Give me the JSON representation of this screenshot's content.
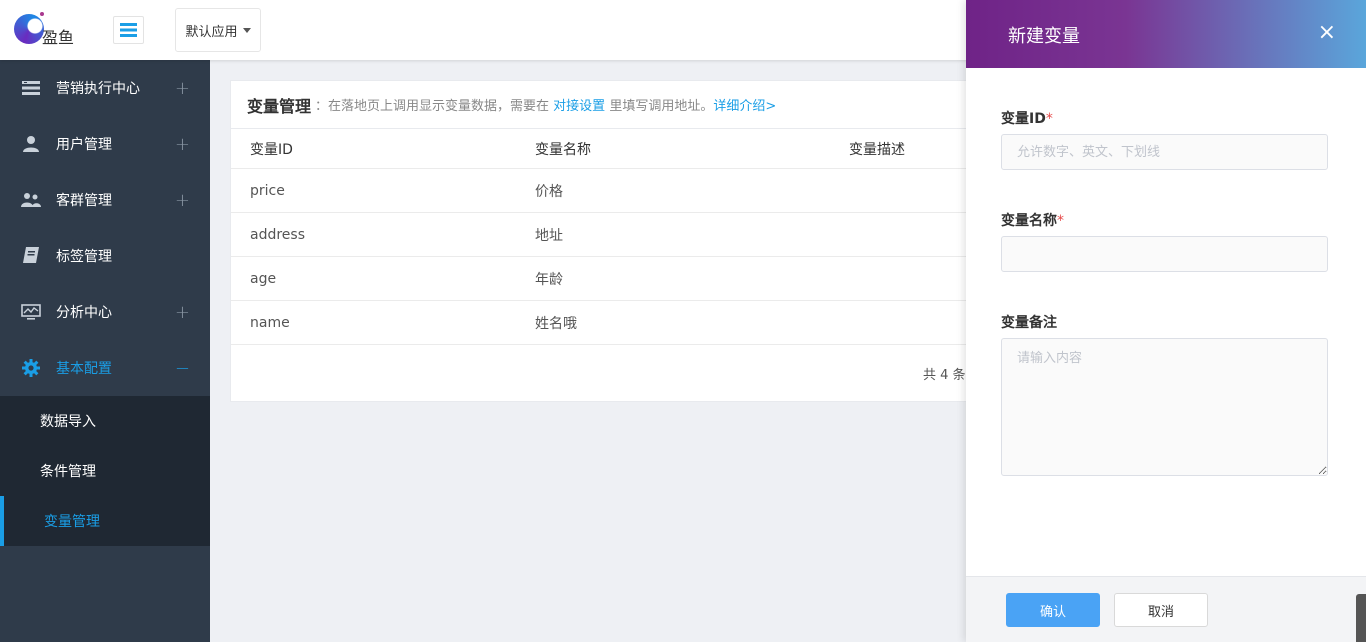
{
  "header": {
    "logo_text": "盈鱼",
    "app_select": "默认应用"
  },
  "sidebar": {
    "items": [
      {
        "label": "营销执行中心",
        "icon": "list-icon",
        "expander": "+"
      },
      {
        "label": "用户管理",
        "icon": "user-icon",
        "expander": "+"
      },
      {
        "label": "客群管理",
        "icon": "group-icon",
        "expander": "+"
      },
      {
        "label": "标签管理",
        "icon": "book-icon",
        "expander": ""
      },
      {
        "label": "分析中心",
        "icon": "monitor-chart-icon",
        "expander": "+"
      },
      {
        "label": "基本配置",
        "icon": "gear-icon",
        "expander": "−"
      }
    ],
    "submenu": [
      {
        "label": "数据导入"
      },
      {
        "label": "条件管理"
      },
      {
        "label": "变量管理"
      }
    ]
  },
  "panel": {
    "title": "变量管理",
    "desc_prefix": "：在落地页上调用显示变量数据，需要在",
    "link_setup": "对接设置",
    "desc_middle": "里填写调用地址。",
    "link_detail": "详细介绍>",
    "columns": [
      "变量ID",
      "变量名称",
      "变量描述"
    ],
    "rows": [
      {
        "id": "price",
        "name": "价格",
        "desc": ""
      },
      {
        "id": "address",
        "name": "地址",
        "desc": ""
      },
      {
        "id": "age",
        "name": "年龄",
        "desc": ""
      },
      {
        "id": "name",
        "name": "姓名哦",
        "desc": ""
      }
    ],
    "pager_text": "共 4 条"
  },
  "drawer": {
    "title": "新建变量",
    "close": "×",
    "field_id_label": "变量ID",
    "field_id_placeholder": "允许数字、英文、下划线",
    "field_name_label": "变量名称",
    "field_name_value": "",
    "field_note_label": "变量备注",
    "field_note_placeholder": "请输入内容",
    "required_mark": "*",
    "confirm": "确认",
    "cancel": "取消"
  },
  "colors": {
    "accent": "#1a9ee6",
    "sidebar_bg": "#2f3b4a",
    "submenu_bg": "#1f2833",
    "drawer_gradient_start": "#6f2387",
    "drawer_gradient_end": "#5aa6db",
    "primary_button": "#4aa3f5"
  }
}
